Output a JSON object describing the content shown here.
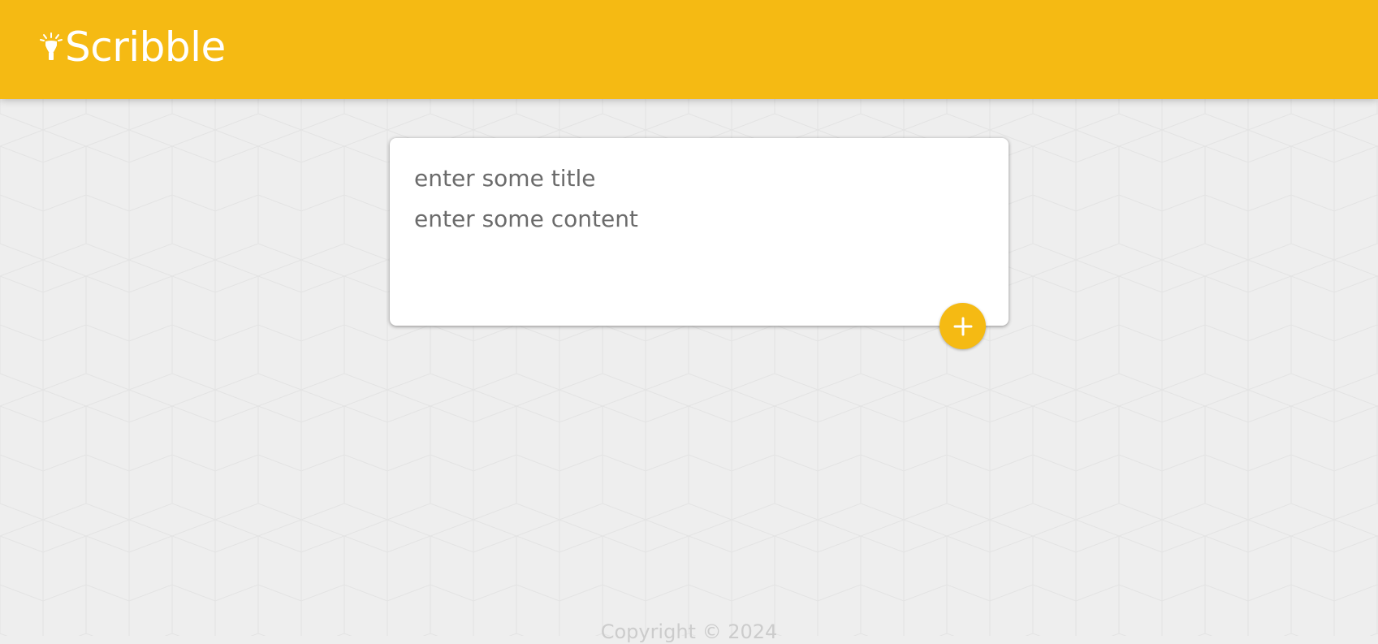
{
  "header": {
    "logo_text": "Scribble",
    "logo_icon": "lightbulb-icon"
  },
  "note_form": {
    "title_placeholder": "enter some title",
    "title_value": "",
    "content_placeholder": "enter some content",
    "content_value": ""
  },
  "add_button": {
    "icon": "plus-icon",
    "label": "+"
  },
  "footer": {
    "copyright": "Copyright © 2024"
  },
  "colors": {
    "brand": "#f5ba13",
    "background": "#eeeeee",
    "card": "#ffffff",
    "placeholder_text": "#6b6b6b",
    "footer_text": "#cccccc"
  }
}
